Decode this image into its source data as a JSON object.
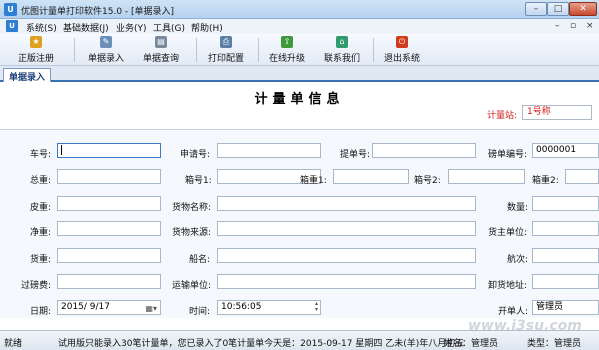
{
  "window": {
    "title": "优图计量单打印软件15.0 - [单据录入]",
    "app_icon": "app-icon",
    "min_glyph": "–",
    "max_glyph": "□",
    "close_glyph": "✕"
  },
  "menu": {
    "items": [
      "系统(S)",
      "基础数据(J)",
      "业务(Y)",
      "工具(G)",
      "帮助(H)"
    ],
    "mdi_controls": [
      "–",
      "▫",
      "×"
    ]
  },
  "toolbar": {
    "items": [
      {
        "label": "正版注册",
        "icon": "register-icon",
        "color": "#e0a020"
      },
      {
        "label": "单据录入",
        "icon": "entry-icon",
        "color": "#6a8fb8"
      },
      {
        "label": "单据查询",
        "icon": "query-icon",
        "color": "#7a8a9a"
      },
      {
        "label": "打印配置",
        "icon": "print-config-icon",
        "color": "#5c7fa6"
      },
      {
        "label": "在线升级",
        "icon": "upgrade-icon",
        "color": "#3c9a3c"
      },
      {
        "label": "联系我们",
        "icon": "contact-icon",
        "color": "#2f9b6e"
      },
      {
        "label": "退出系统",
        "icon": "exit-icon",
        "color": "#d23a1c"
      }
    ]
  },
  "tab": {
    "label": "单据录入"
  },
  "form": {
    "title": "计量单信息",
    "station_label": "计量站:",
    "station_value": "1号称",
    "fields": {
      "plate_no": {
        "label": "车号:",
        "value": ""
      },
      "application_no": {
        "label": "申请号:",
        "value": ""
      },
      "bill_no": {
        "label": "提单号:",
        "value": ""
      },
      "pound_no": {
        "label": "磅单编号:",
        "value": "0000001"
      },
      "gross": {
        "label": "总重:",
        "value": ""
      },
      "box_no1": {
        "label": "箱号1:",
        "value": ""
      },
      "box_weight1": {
        "label": "箱重1:",
        "value": ""
      },
      "box_no2": {
        "label": "箱号2:",
        "value": ""
      },
      "box_weight2": {
        "label": "箱重2:",
        "value": ""
      },
      "tare": {
        "label": "皮重:",
        "value": ""
      },
      "goods_name": {
        "label": "货物名称:",
        "value": ""
      },
      "quantity": {
        "label": "数量:",
        "value": ""
      },
      "net": {
        "label": "净重:",
        "value": ""
      },
      "goods_source": {
        "label": "货物来源:",
        "value": ""
      },
      "owner_unit": {
        "label": "货主单位:",
        "value": ""
      },
      "cargo_weight": {
        "label": "货重:",
        "value": ""
      },
      "ship_name": {
        "label": "船名:",
        "value": ""
      },
      "voyage": {
        "label": "航次:",
        "value": ""
      },
      "weighing_fee": {
        "label": "过磅费:",
        "value": ""
      },
      "transport_unit": {
        "label": "运输单位:",
        "value": ""
      },
      "unload_place": {
        "label": "卸货地址:",
        "value": ""
      },
      "date": {
        "label": "日期:",
        "value": "2015/  9/17"
      },
      "time": {
        "label": "时间:",
        "value": "10:56:05"
      },
      "issuer": {
        "label": "开单人:",
        "value": "管理员"
      }
    }
  },
  "status": {
    "ready": "就绪",
    "message": "试用版只能录入30笔计量单，您已录入了0笔计量单今天是：2015-09-17 星期四 乙未(羊)年八月初五",
    "name": "姓名：管理员",
    "type": "类型：管理员"
  },
  "watermark": "www.i3su.com"
}
